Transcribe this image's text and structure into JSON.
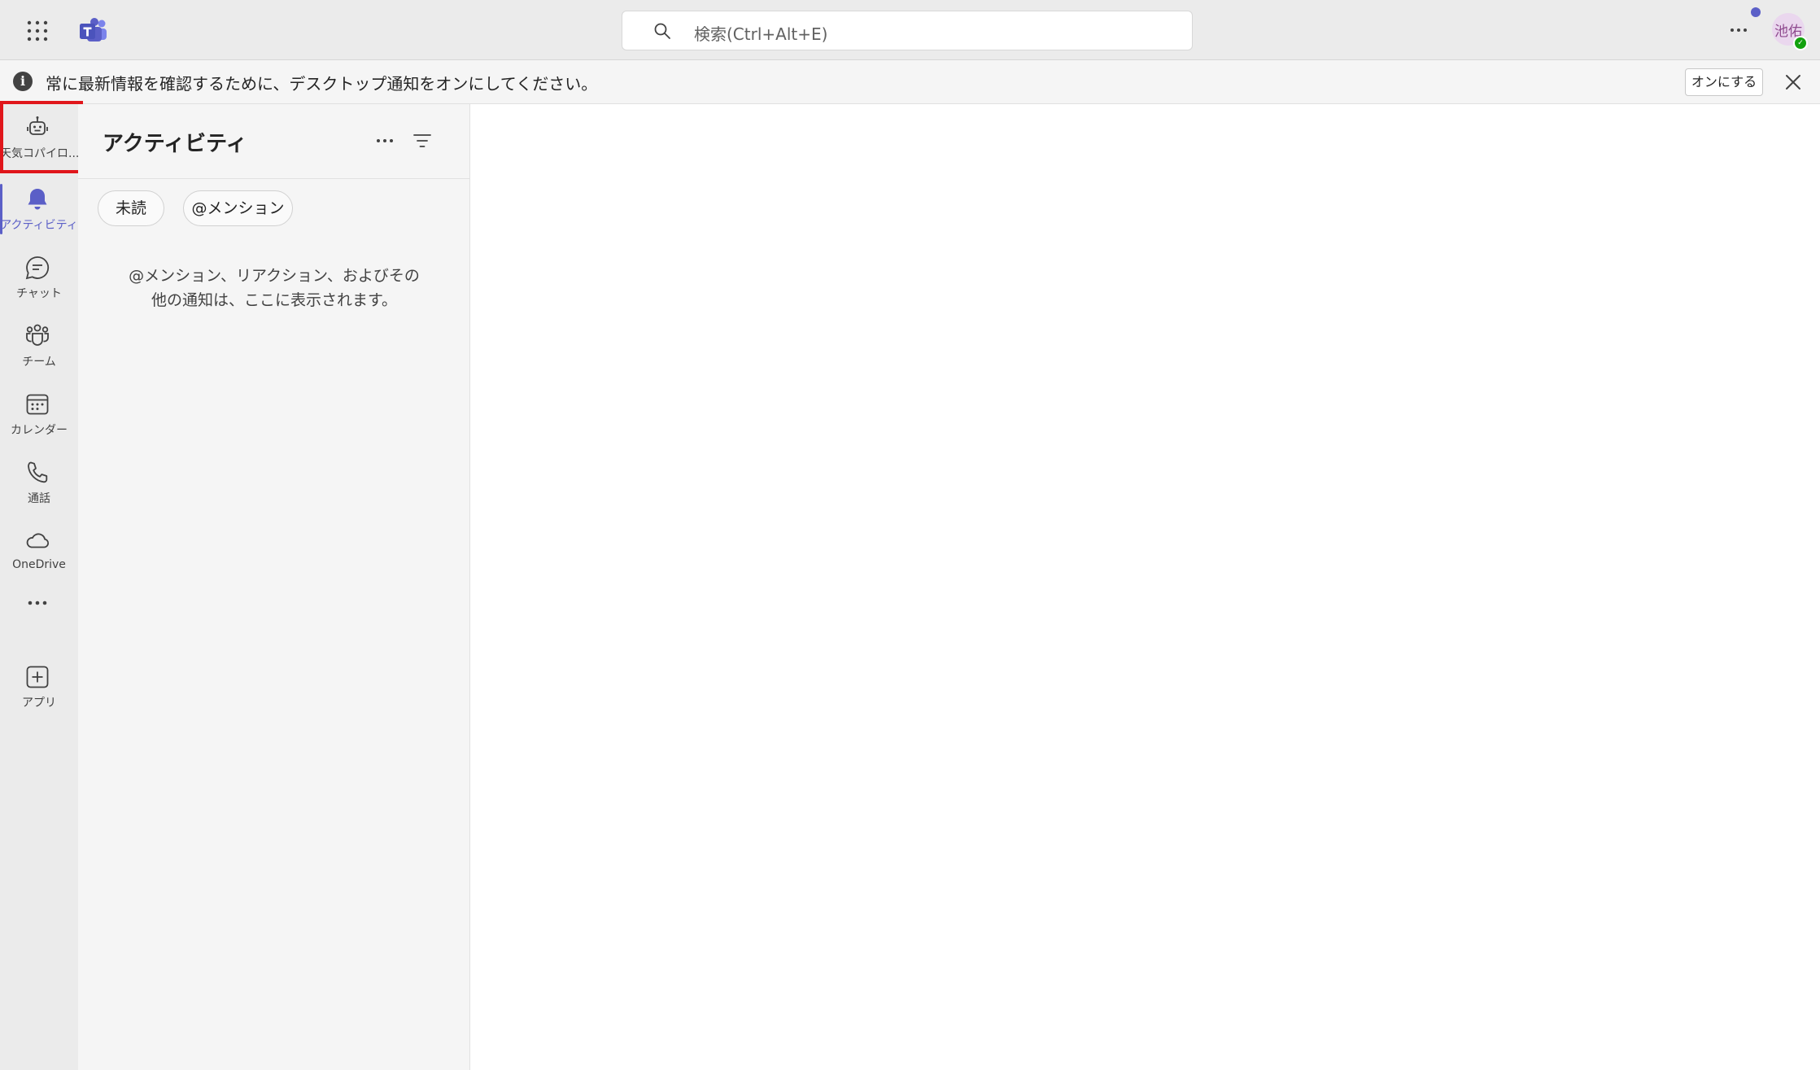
{
  "titlebar": {
    "search_placeholder": "検索(Ctrl+Alt+E)",
    "avatar_initials": "池佑"
  },
  "banner": {
    "message": "常に最新情報を確認するために、デスクトップ通知をオンにしてください。",
    "button_label": "オンにする"
  },
  "rail": {
    "items": [
      {
        "label": "天気コパイロ...",
        "icon": "bot-icon"
      },
      {
        "label": "アクティビティ",
        "icon": "bell-icon",
        "active": true
      },
      {
        "label": "チャット",
        "icon": "chat-icon"
      },
      {
        "label": "チーム",
        "icon": "teams-icon"
      },
      {
        "label": "カレンダー",
        "icon": "calendar-icon"
      },
      {
        "label": "通話",
        "icon": "phone-icon"
      },
      {
        "label": "OneDrive",
        "icon": "cloud-icon"
      },
      {
        "label": "",
        "icon": "more-icon"
      },
      {
        "label": "アプリ",
        "icon": "add-app-icon"
      }
    ]
  },
  "activity": {
    "title": "アクティビティ",
    "filters": [
      "未読",
      "@メンション"
    ],
    "empty_message": "@メンション、リアクション、およびその他の通知は、ここに表示されます。"
  },
  "colors": {
    "accent": "#5b5fc7",
    "highlight": "#e0161b",
    "presence": "#13a10e"
  }
}
